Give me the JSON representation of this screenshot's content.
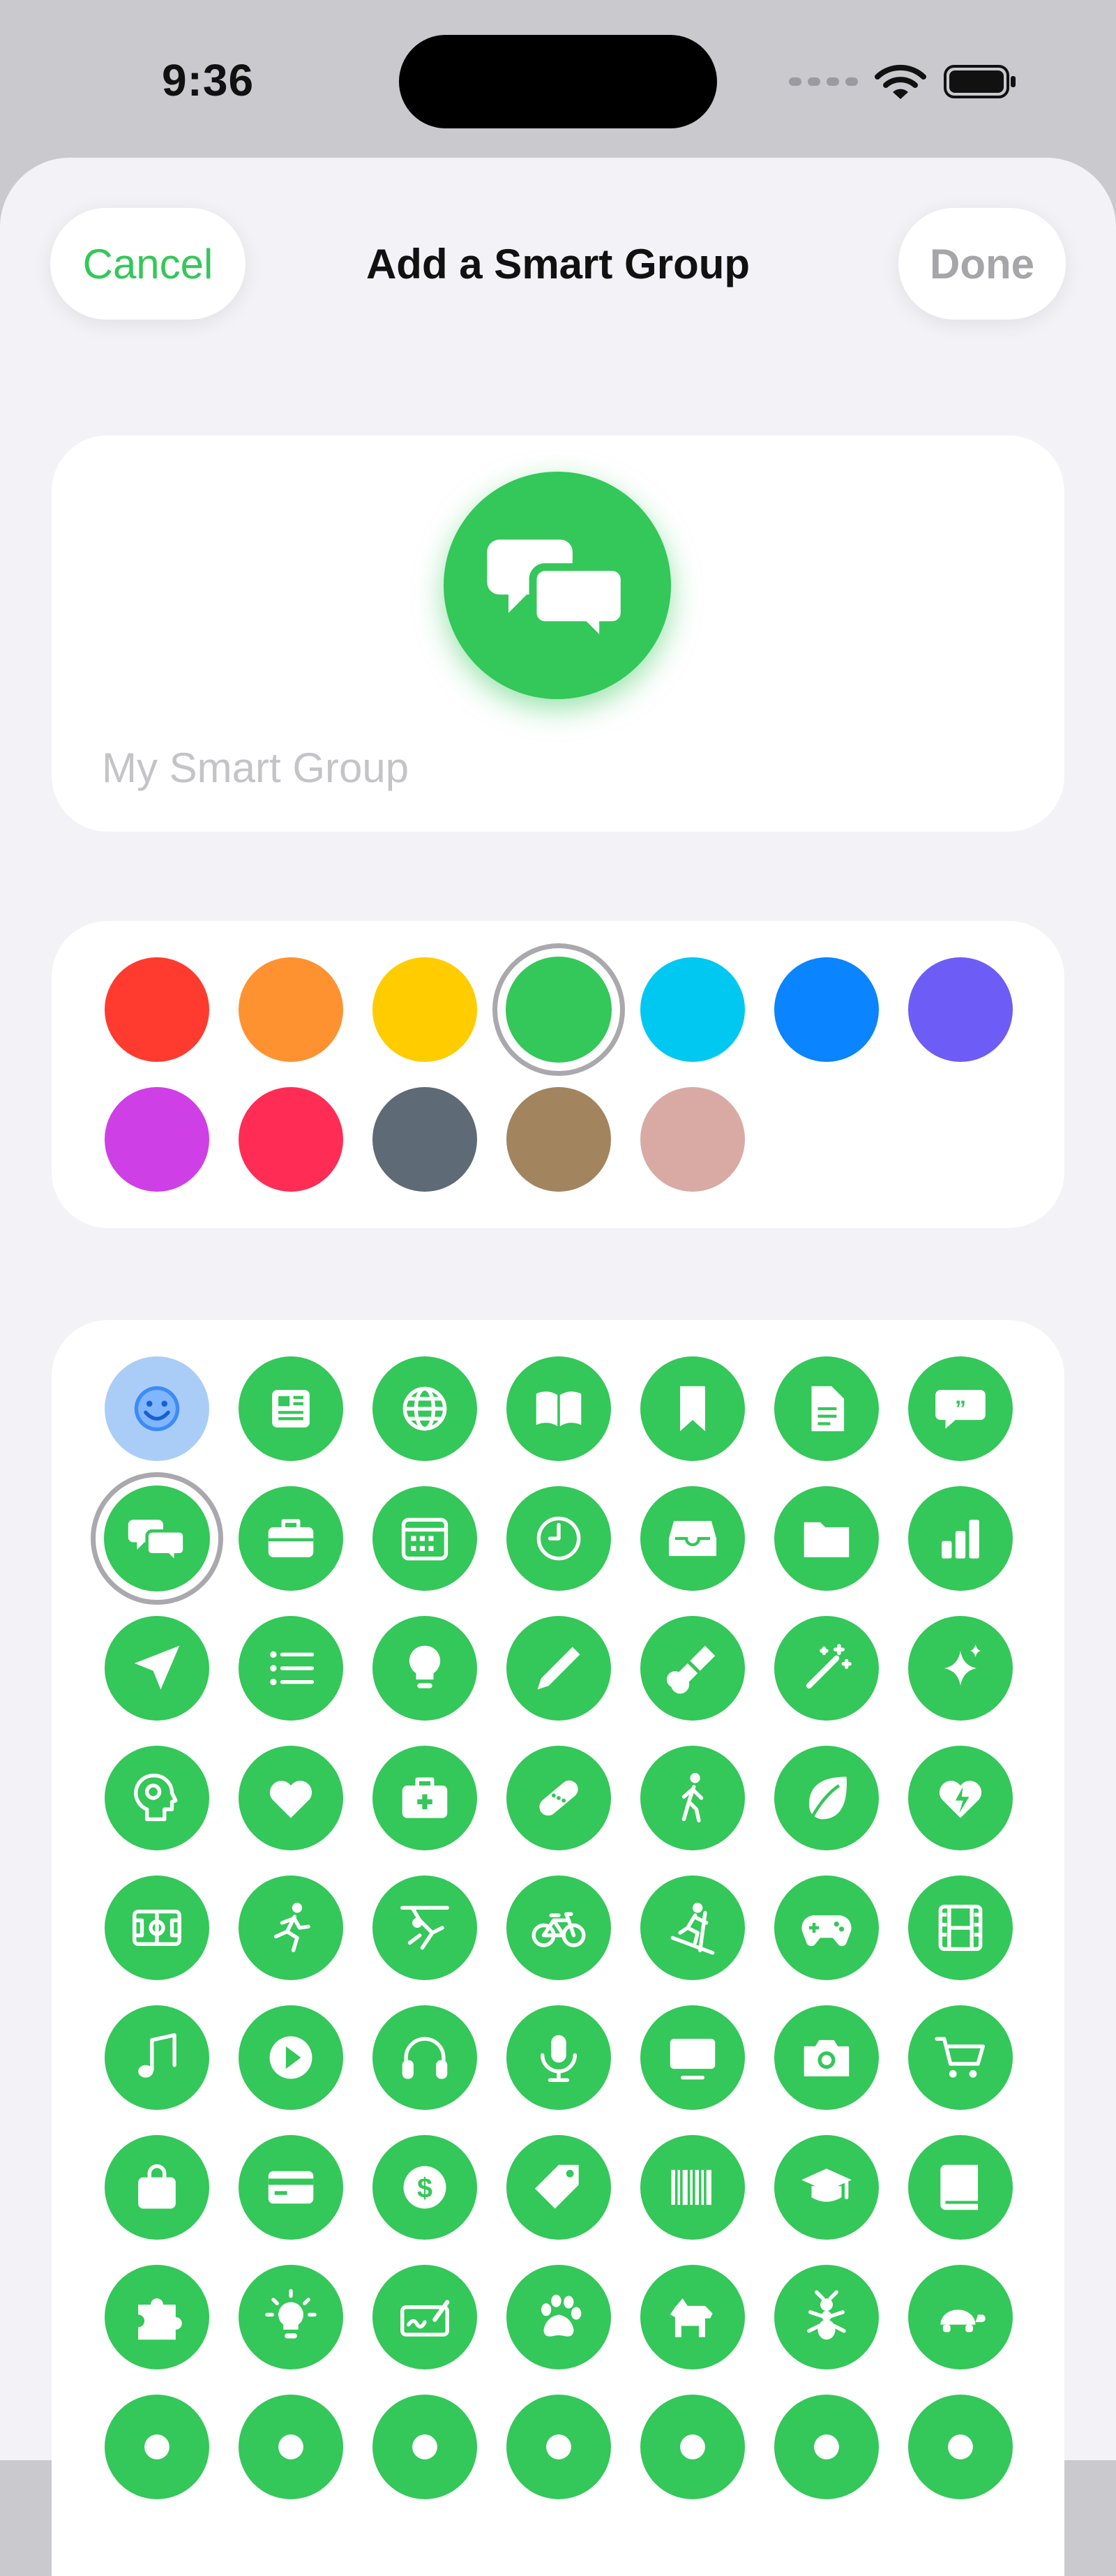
{
  "status_bar": {
    "time": "9:36"
  },
  "nav": {
    "cancel_label": "Cancel",
    "title": "Add a Smart Group",
    "done_label": "Done"
  },
  "name_field": {
    "placeholder": "My Smart Group",
    "value": ""
  },
  "selected_icon": "speech-bubbles-icon",
  "accent_color": "#34c759",
  "colors": {
    "selected_index": 3,
    "swatches": [
      {
        "name": "red",
        "hex": "#ff3b30"
      },
      {
        "name": "orange",
        "hex": "#ff9230"
      },
      {
        "name": "yellow",
        "hex": "#ffcc00"
      },
      {
        "name": "green",
        "hex": "#34c759"
      },
      {
        "name": "cyan",
        "hex": "#00c8f0"
      },
      {
        "name": "blue",
        "hex": "#0a84ff"
      },
      {
        "name": "purple",
        "hex": "#6e5cf6"
      },
      {
        "name": "magenta",
        "hex": "#cf3fe6"
      },
      {
        "name": "pink",
        "hex": "#ff2d55"
      },
      {
        "name": "gray",
        "hex": "#5e6a75"
      },
      {
        "name": "brown",
        "hex": "#a2845e"
      },
      {
        "name": "rose",
        "hex": "#d9aaa3"
      }
    ]
  },
  "icons": {
    "selected_index": 7,
    "items": [
      "smiley-icon",
      "newspaper-icon",
      "globe-icon",
      "book-icon",
      "bookmark-icon",
      "document-icon",
      "quote-bubble-icon",
      "speech-bubbles-icon",
      "briefcase-icon",
      "calendar-icon",
      "clock-icon",
      "tray-icon",
      "folder-icon",
      "bar-chart-icon",
      "paper-plane-icon",
      "list-icon",
      "lightbulb-icon",
      "pencil-icon",
      "paintbrush-icon",
      "magic-wand-icon",
      "sparkles-icon",
      "brain-head-icon",
      "heart-icon",
      "first-aid-kit-icon",
      "bandage-icon",
      "walking-figure-icon",
      "leaf-icon",
      "heart-bolt-icon",
      "soccer-field-icon",
      "running-figure-icon",
      "gymnastics-figure-icon",
      "bicycle-icon",
      "skiing-figure-icon",
      "game-controller-icon",
      "film-strip-icon",
      "music-note-icon",
      "play-icon",
      "headphones-icon",
      "microphone-icon",
      "tv-icon",
      "camera-icon",
      "cart-icon",
      "shopping-bag-icon",
      "credit-card-icon",
      "dollar-icon",
      "tag-icon",
      "barcode-icon",
      "graduation-cap-icon",
      "book-closed-icon",
      "puzzle-piece-icon",
      "idea-bulb-icon",
      "signature-icon",
      "paw-print-icon",
      "dog-icon",
      "ant-icon",
      "turtle-icon",
      "partial-icon-1",
      "partial-icon-2",
      "partial-icon-3",
      "partial-icon-4",
      "partial-icon-5",
      "partial-icon-6",
      "partial-icon-7"
    ]
  }
}
